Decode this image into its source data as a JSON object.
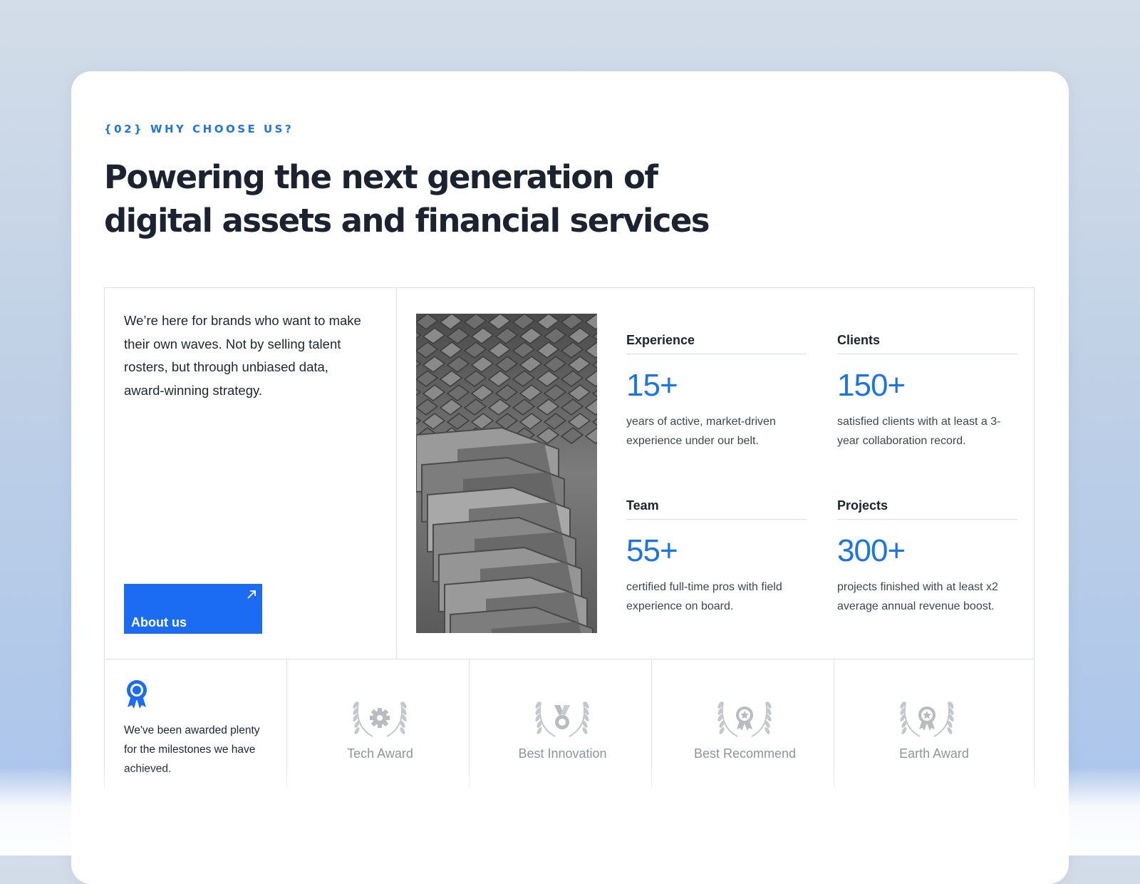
{
  "section": {
    "eyebrow": "{02} WHY CHOOSE US?",
    "headline_line1": "Powering the next generation of",
    "headline_line2": "digital assets and financial services"
  },
  "intro": {
    "text": "We’re here for brands who want to make their own waves. Not by selling talent rosters, but through unbiased data, award-winning strategy.",
    "button_label": "About us",
    "button_icon": "arrow-up-right-icon"
  },
  "photo": {
    "icon": "concrete-architecture-photo"
  },
  "stats": [
    {
      "label": "Experience",
      "value": "15+",
      "description": "years of active, market-driven experience under our belt."
    },
    {
      "label": "Clients",
      "value": "150+",
      "description": "satisfied clients with at least a 3-year collaboration record."
    },
    {
      "label": "Team",
      "value": "55+",
      "description": "certified full-time pros with field experience on board."
    },
    {
      "label": "Projects",
      "value": "300+",
      "description": "projects finished with at least x2 average annual revenue boost."
    }
  ],
  "awards": {
    "intro_icon": "award-ribbon-icon",
    "intro_text": "We've been awarded plenty for the milestones we have achieved.",
    "items": [
      {
        "name": "Tech Award",
        "icon": "gear-laurel-icon"
      },
      {
        "name": "Best Innovation",
        "icon": "medal-laurel-icon"
      },
      {
        "name": "Best Recommend",
        "icon": "star-badge-laurel-icon"
      },
      {
        "name": "Earth Award",
        "icon": "star-badge-laurel-icon"
      }
    ]
  },
  "colors": {
    "accent": "#1b6cf2",
    "stat_value": "#1b74e6",
    "heading": "#1b2330",
    "award_gray": "#8e949d"
  }
}
